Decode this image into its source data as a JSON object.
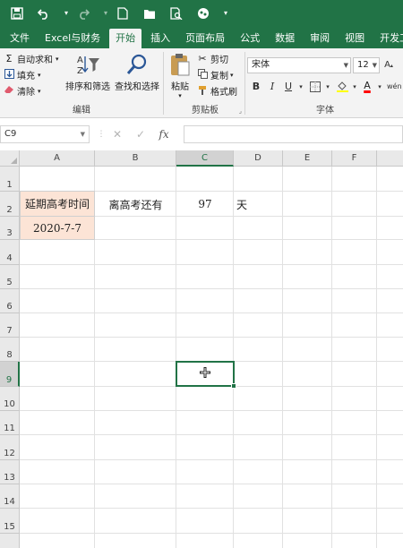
{
  "quick_access": {
    "icons": [
      "save-icon",
      "undo-icon",
      "redo-icon",
      "new-file-icon",
      "open-folder-icon",
      "print-preview-icon",
      "share-icon",
      "customize-icon"
    ]
  },
  "ribbon_tabs": [
    "文件",
    "Excel与财务",
    "开始",
    "插入",
    "页面布局",
    "公式",
    "数据",
    "审阅",
    "视图",
    "开发工具"
  ],
  "active_tab": "开始",
  "ribbon": {
    "editing": {
      "autosum": "自动求和",
      "fill": "填充",
      "clear": "清除",
      "sort_filter": "排序和筛选",
      "find_select": "查找和选择",
      "group_label": "编辑"
    },
    "clipboard": {
      "paste": "粘贴",
      "cut": "剪切",
      "copy": "复制",
      "format_painter": "格式刷",
      "group_label": "剪贴板"
    },
    "font": {
      "font_name": "宋体",
      "font_size": "12",
      "bold": "B",
      "italic": "I",
      "underline": "U",
      "font_color_letter": "A",
      "group_label": "字体",
      "font_color": "#ff0000"
    }
  },
  "formula_bar": {
    "name_box": "C9",
    "fx": "fx",
    "formula": ""
  },
  "sheet": {
    "columns": [
      "A",
      "B",
      "C",
      "D",
      "E",
      "F"
    ],
    "selected_column": "C",
    "rows": [
      "1",
      "2",
      "3",
      "4",
      "5",
      "6",
      "7",
      "8",
      "9",
      "10",
      "11",
      "12",
      "13",
      "14",
      "15"
    ],
    "selected_row": "9",
    "cells": {
      "A2": "延期高考时间",
      "B2": "离高考还有",
      "C2": "97",
      "D2": "天",
      "A3": "2020-7-7"
    },
    "highlight_color": "#fce4d6",
    "accent_color": "#217346"
  }
}
